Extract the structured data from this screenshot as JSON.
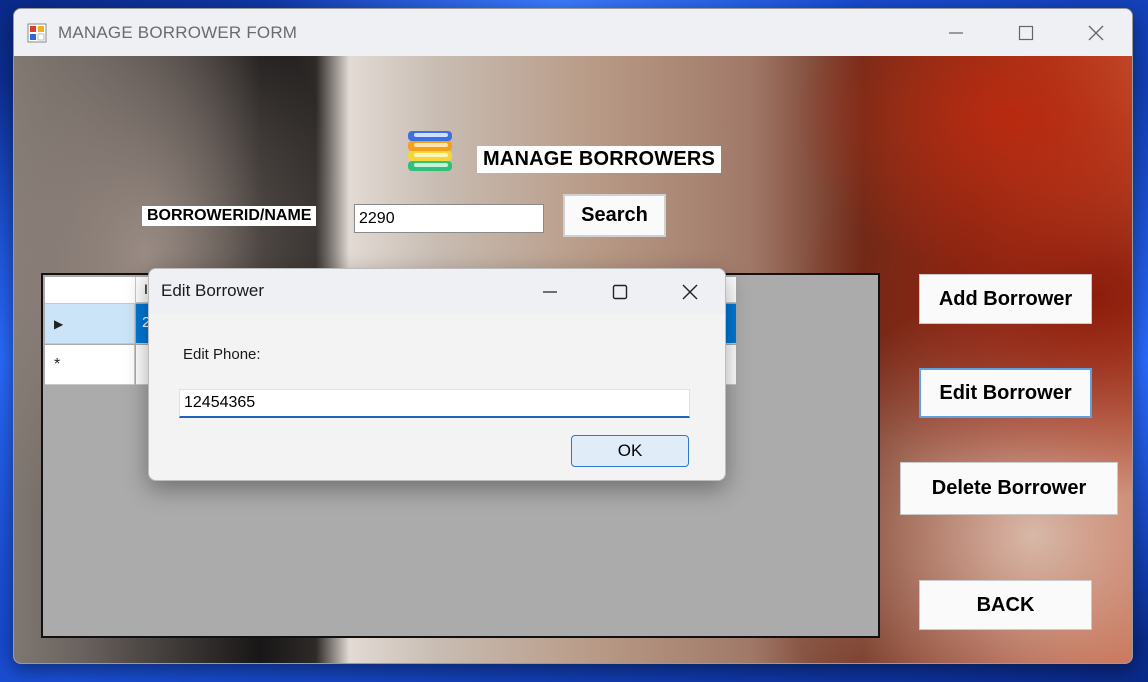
{
  "window": {
    "title": "MANAGE BORROWER FORM",
    "icons": {
      "app": "form-app-icon",
      "minimize": "minimize-icon",
      "maximize": "maximize-icon",
      "close": "close-icon"
    }
  },
  "form": {
    "heading": "MANAGE BORROWERS",
    "heading_icon": "books-stack-icon",
    "search_label": "BORROWERID/NAME",
    "search_value": "2290",
    "search_button": "Search",
    "buttons": {
      "add": "Add Borrower",
      "edit": "Edit Borrower",
      "delete": "Delete Borrower",
      "back": "BACK"
    }
  },
  "grid": {
    "header_visible": "I",
    "row1_value": "2",
    "row1_indicator": "▶",
    "new_row_indicator": "*"
  },
  "dialog": {
    "title": "Edit Borrower",
    "label": "Edit Phone:",
    "input_value": "12454365",
    "ok": "OK"
  },
  "colors": {
    "selection": "#0078d7",
    "input_focus": "#1f63c0",
    "ok_border": "#2e78c8"
  }
}
